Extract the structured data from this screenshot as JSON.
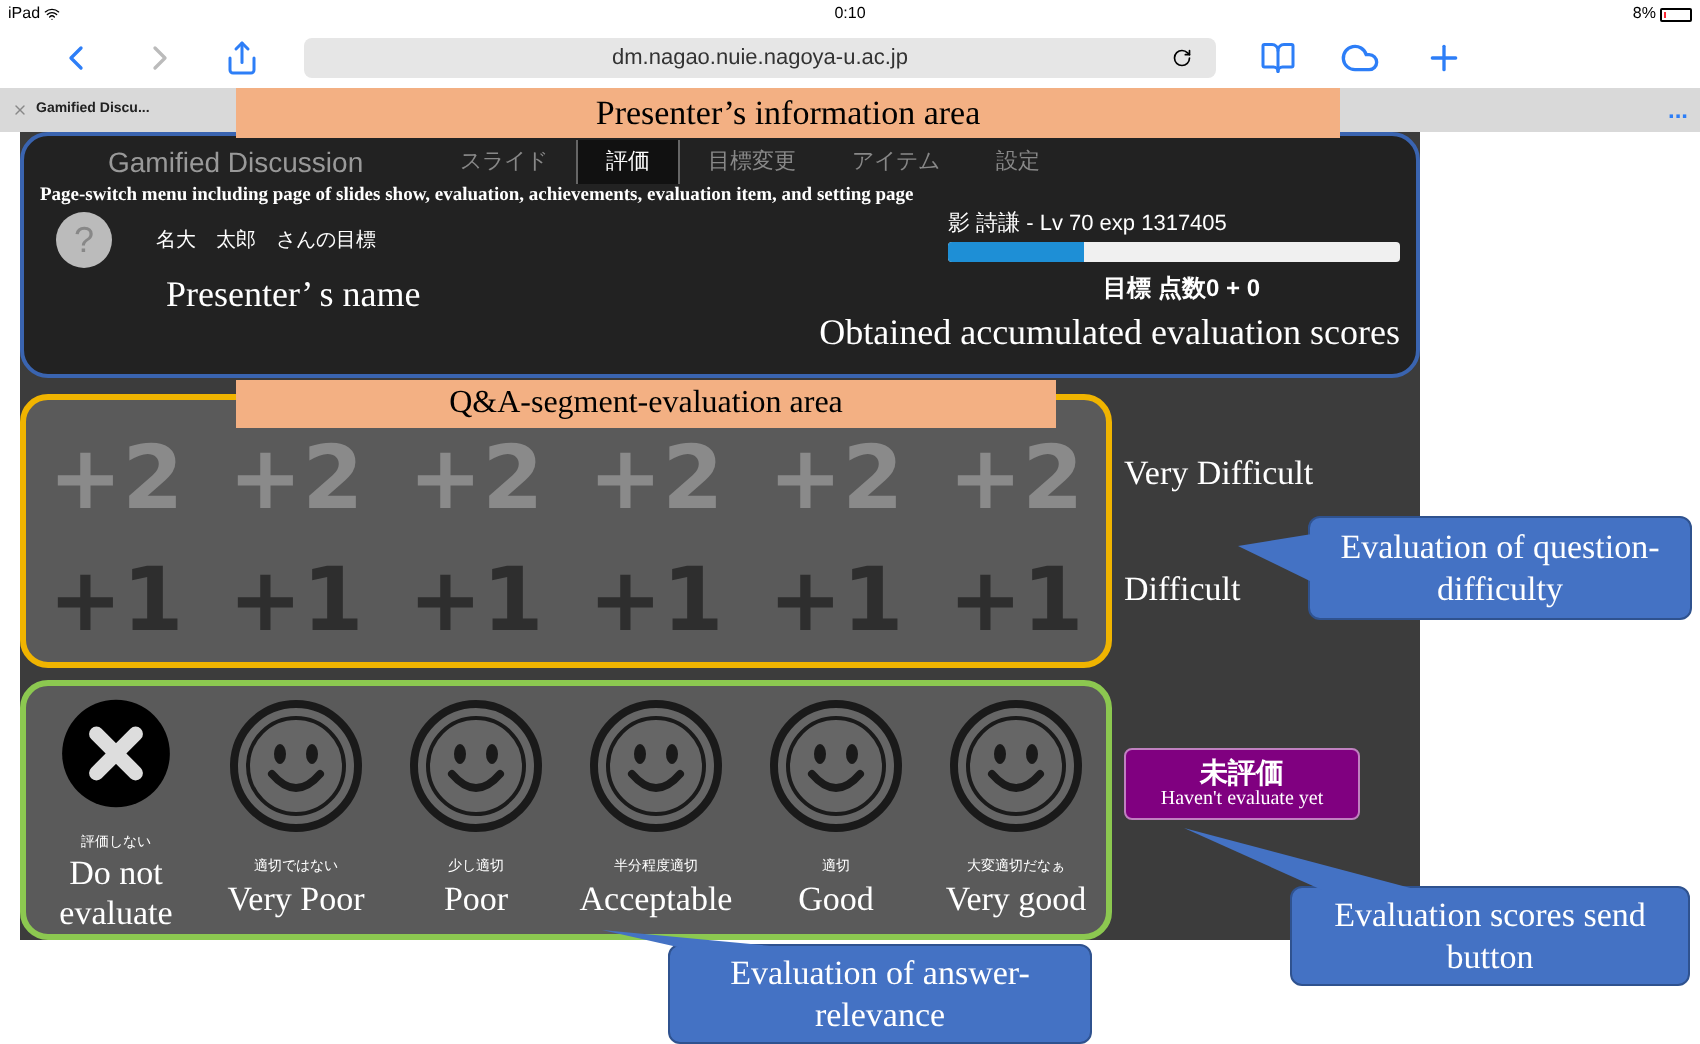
{
  "status_bar": {
    "device": "iPad",
    "time": "0:10",
    "battery": "8%"
  },
  "browser": {
    "url": "dm.nagao.nuie.nagoya-u.ac.jp",
    "tab_title": "Gamified Discu...",
    "more": "..."
  },
  "app": {
    "title": "Gamified Discussion",
    "tabs": [
      {
        "label": "スライド",
        "selected": false
      },
      {
        "label": "評価",
        "selected": true
      },
      {
        "label": "目標変更",
        "selected": false
      },
      {
        "label": "アイテム",
        "selected": false
      },
      {
        "label": "設定",
        "selected": false
      }
    ],
    "menu_note": "Page-switch menu including page of slides show, evaluation, achievements, evaluation item, and setting page",
    "avatar": "?",
    "presenter": "名大　太郎　さんの目標",
    "presenter_note": "Presenter’ s name",
    "level_text": "影 詩謙 - Lv 70 exp 1317405",
    "level": 0.3,
    "score": "目標 点数0 + 0",
    "score_note": "Obtained accumulated evaluation scores"
  },
  "difficulty": {
    "rows": [
      {
        "buttons": [
          "+2",
          "+2",
          "+2",
          "+2",
          "+2",
          "+2"
        ],
        "caption": "Very Difficult"
      },
      {
        "buttons": [
          "+1",
          "+1",
          "+1",
          "+1",
          "+1",
          "+1"
        ],
        "caption": "Difficult"
      }
    ]
  },
  "relevance": {
    "options": [
      {
        "kind": "cross",
        "jp": "評価しない",
        "en": "Do not evaluate"
      },
      {
        "kind": "smile",
        "jp": "適切ではない",
        "en": "Very Poor"
      },
      {
        "kind": "smile",
        "jp": "少し適切",
        "en": "Poor"
      },
      {
        "kind": "smile",
        "jp": "半分程度適切",
        "en": "Acceptable"
      },
      {
        "kind": "smile",
        "jp": "適切",
        "en": "Good"
      },
      {
        "kind": "smile",
        "jp": "大変適切だなぁ",
        "en": "Very good"
      }
    ]
  },
  "send_button": {
    "label": "未評価",
    "caption": "Haven't evaluate yet"
  },
  "annotations": {
    "presenter_area": "Presenter’s information area",
    "qa_area": "Q&A-segment-evaluation area",
    "callouts": [
      {
        "kind": "difficulty",
        "text": "Evaluation of question-difficulty"
      },
      {
        "kind": "send",
        "text": "Evaluation scores send button"
      },
      {
        "kind": "relevance",
        "text": "Evaluation of answer-relevance"
      }
    ]
  }
}
